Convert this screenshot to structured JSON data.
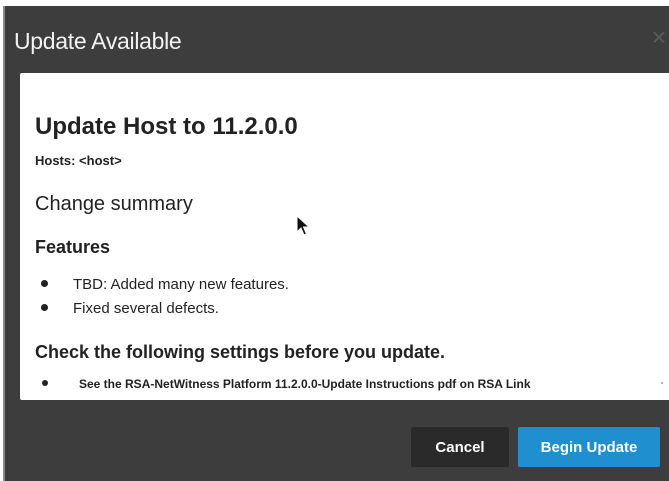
{
  "dialog": {
    "title": "Update Available",
    "close_icon": "close-icon"
  },
  "content": {
    "heading": "Update Host to 11.2.0.0",
    "hosts": "Hosts: <host>",
    "change_summary": "Change summary",
    "features_heading": "Features",
    "features": [
      "TBD: Added many new features.",
      "Fixed several defects."
    ],
    "check_heading": "Check the following settings before you update.",
    "check_items": [
      "See the RSA-NetWitness Platform 11.2.0.0-Update Instructions pdf on RSA Link"
    ]
  },
  "footer": {
    "cancel_label": "Cancel",
    "begin_label": "Begin Update"
  },
  "colors": {
    "titlebar": "#3d3d3d",
    "primary_button": "#1f8fd0",
    "cancel_button": "#2a2a2a"
  }
}
